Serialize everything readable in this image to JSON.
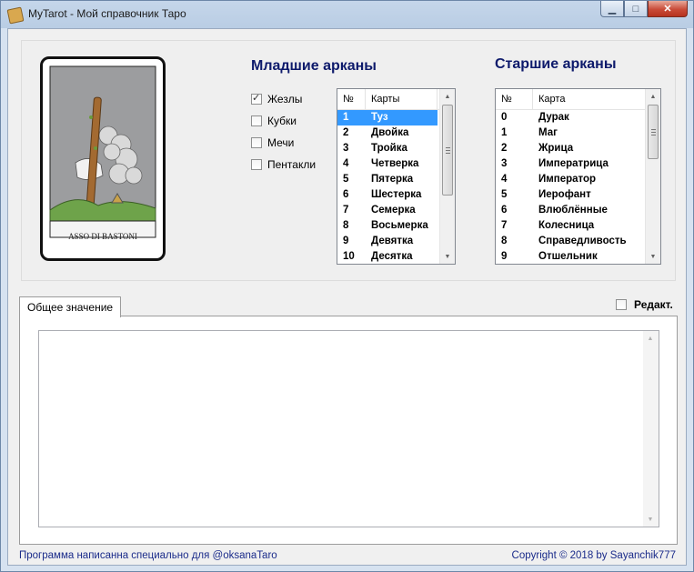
{
  "window": {
    "title": "MyTarot - Мой справочник Таро",
    "buttons": {
      "minimize": "▁",
      "maximize": "□",
      "close": "✕"
    }
  },
  "card_image": {
    "caption": "ASSO DI BASTONI"
  },
  "minor_arcana": {
    "heading": "Младшие арканы",
    "suits": [
      {
        "label": "Жезлы",
        "checked": true
      },
      {
        "label": "Кубки",
        "checked": false
      },
      {
        "label": "Мечи",
        "checked": false
      },
      {
        "label": "Пентакли",
        "checked": false
      }
    ],
    "columns": {
      "num": "№",
      "name": "Карты"
    },
    "rows": [
      {
        "num": "1",
        "name": "Туз",
        "selected": true
      },
      {
        "num": "2",
        "name": "Двойка"
      },
      {
        "num": "3",
        "name": "Тройка"
      },
      {
        "num": "4",
        "name": "Четверка"
      },
      {
        "num": "5",
        "name": "Пятерка"
      },
      {
        "num": "6",
        "name": "Шестерка"
      },
      {
        "num": "7",
        "name": "Семерка"
      },
      {
        "num": "8",
        "name": "Восьмерка"
      },
      {
        "num": "9",
        "name": "Девятка"
      },
      {
        "num": "10",
        "name": "Десятка"
      }
    ]
  },
  "major_arcana": {
    "heading": "Старшие арканы",
    "columns": {
      "num": "№",
      "name": "Карта"
    },
    "rows": [
      {
        "num": "0",
        "name": "Дурак"
      },
      {
        "num": "1",
        "name": "Маг"
      },
      {
        "num": "2",
        "name": "Жрица"
      },
      {
        "num": "3",
        "name": "Императрица"
      },
      {
        "num": "4",
        "name": "Император"
      },
      {
        "num": "5",
        "name": "Иерофант"
      },
      {
        "num": "6",
        "name": "Влюблённые"
      },
      {
        "num": "7",
        "name": "Колесница"
      },
      {
        "num": "8",
        "name": "Справедливость"
      },
      {
        "num": "9",
        "name": "Отшельник"
      }
    ]
  },
  "meaning": {
    "tab_label": "Общее значение",
    "edit_label": "Редакт.",
    "edit_checked": false,
    "text": ""
  },
  "footer": {
    "left": "Программа написанна специально для @oksanaTaro",
    "right": "Copyright © 2018 by Sayanchik777"
  }
}
